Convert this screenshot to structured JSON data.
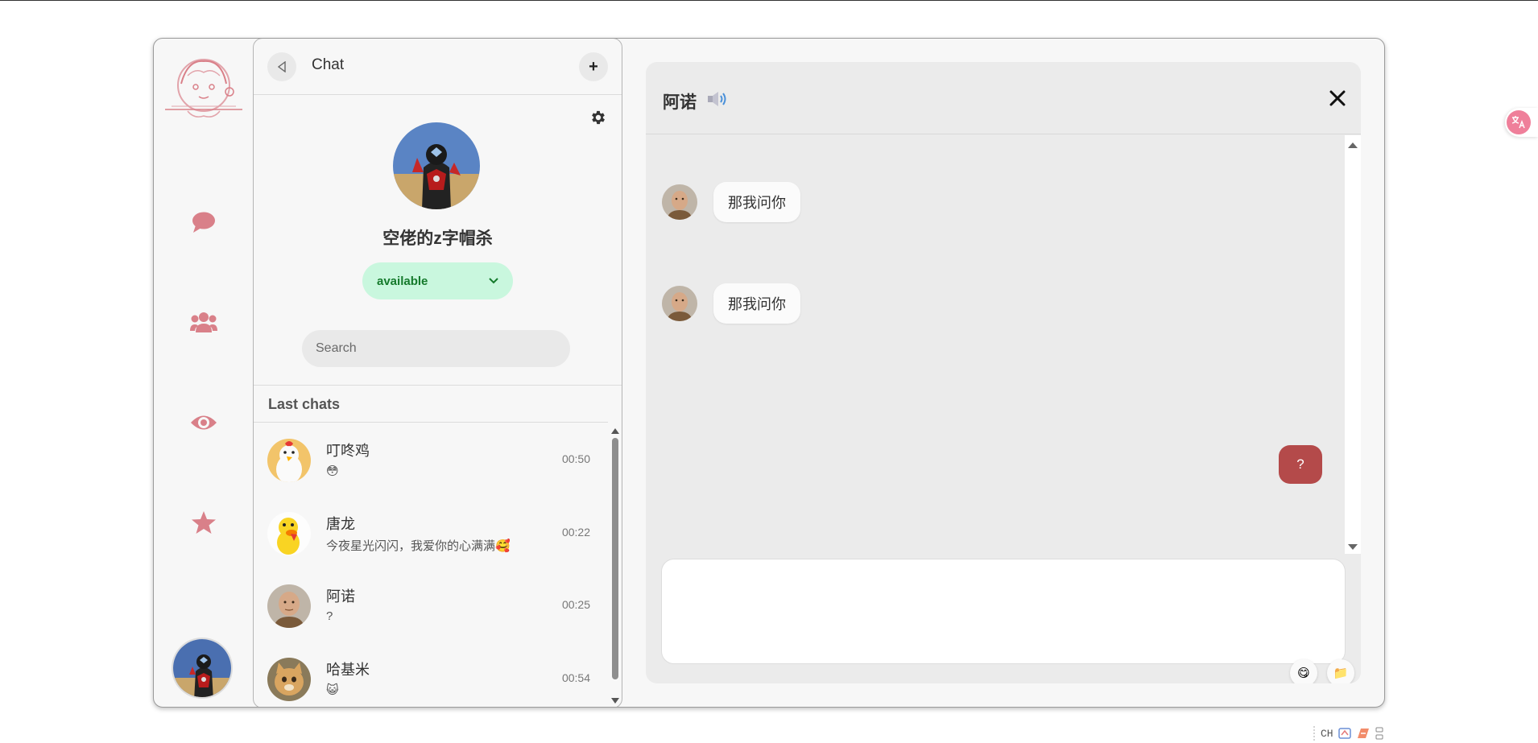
{
  "panel": {
    "title": "Chat",
    "add_label": "+",
    "profile_name": "空佬的z字帽杀",
    "status": "available",
    "search_placeholder": "Search",
    "last_chats_title": "Last chats"
  },
  "chats": [
    {
      "name": "叮咚鸡",
      "message": "😳",
      "time": "00:50"
    },
    {
      "name": "唐龙",
      "message": "今夜星光闪闪，我爱你的心满满🥰",
      "time": "00:22"
    },
    {
      "name": "阿诺",
      "message": "?",
      "time": "00:25"
    },
    {
      "name": "哈基米",
      "message": "😺",
      "time": "00:54"
    }
  ],
  "conversation": {
    "title": "阿诺",
    "messages": [
      {
        "from": "other",
        "text": "那我问你"
      },
      {
        "from": "other",
        "text": "那我问你"
      },
      {
        "from": "me",
        "text": "?"
      }
    ],
    "emoji_button": "😋",
    "file_button": "📁"
  },
  "tray": {
    "ime_label": "CH"
  },
  "colors": {
    "accent": "#d98089",
    "my_bubble": "#b44a4a",
    "status_bg": "#c9f7de",
    "status_text": "#157a2c"
  },
  "icons": [
    "back-icon",
    "plus-icon",
    "gear-icon",
    "chevron-down-icon",
    "chat-bubble-icon",
    "users-icon",
    "eye-icon",
    "star-icon",
    "speaker-icon",
    "close-icon",
    "emoji-icon",
    "folder-icon",
    "translate-icon"
  ]
}
